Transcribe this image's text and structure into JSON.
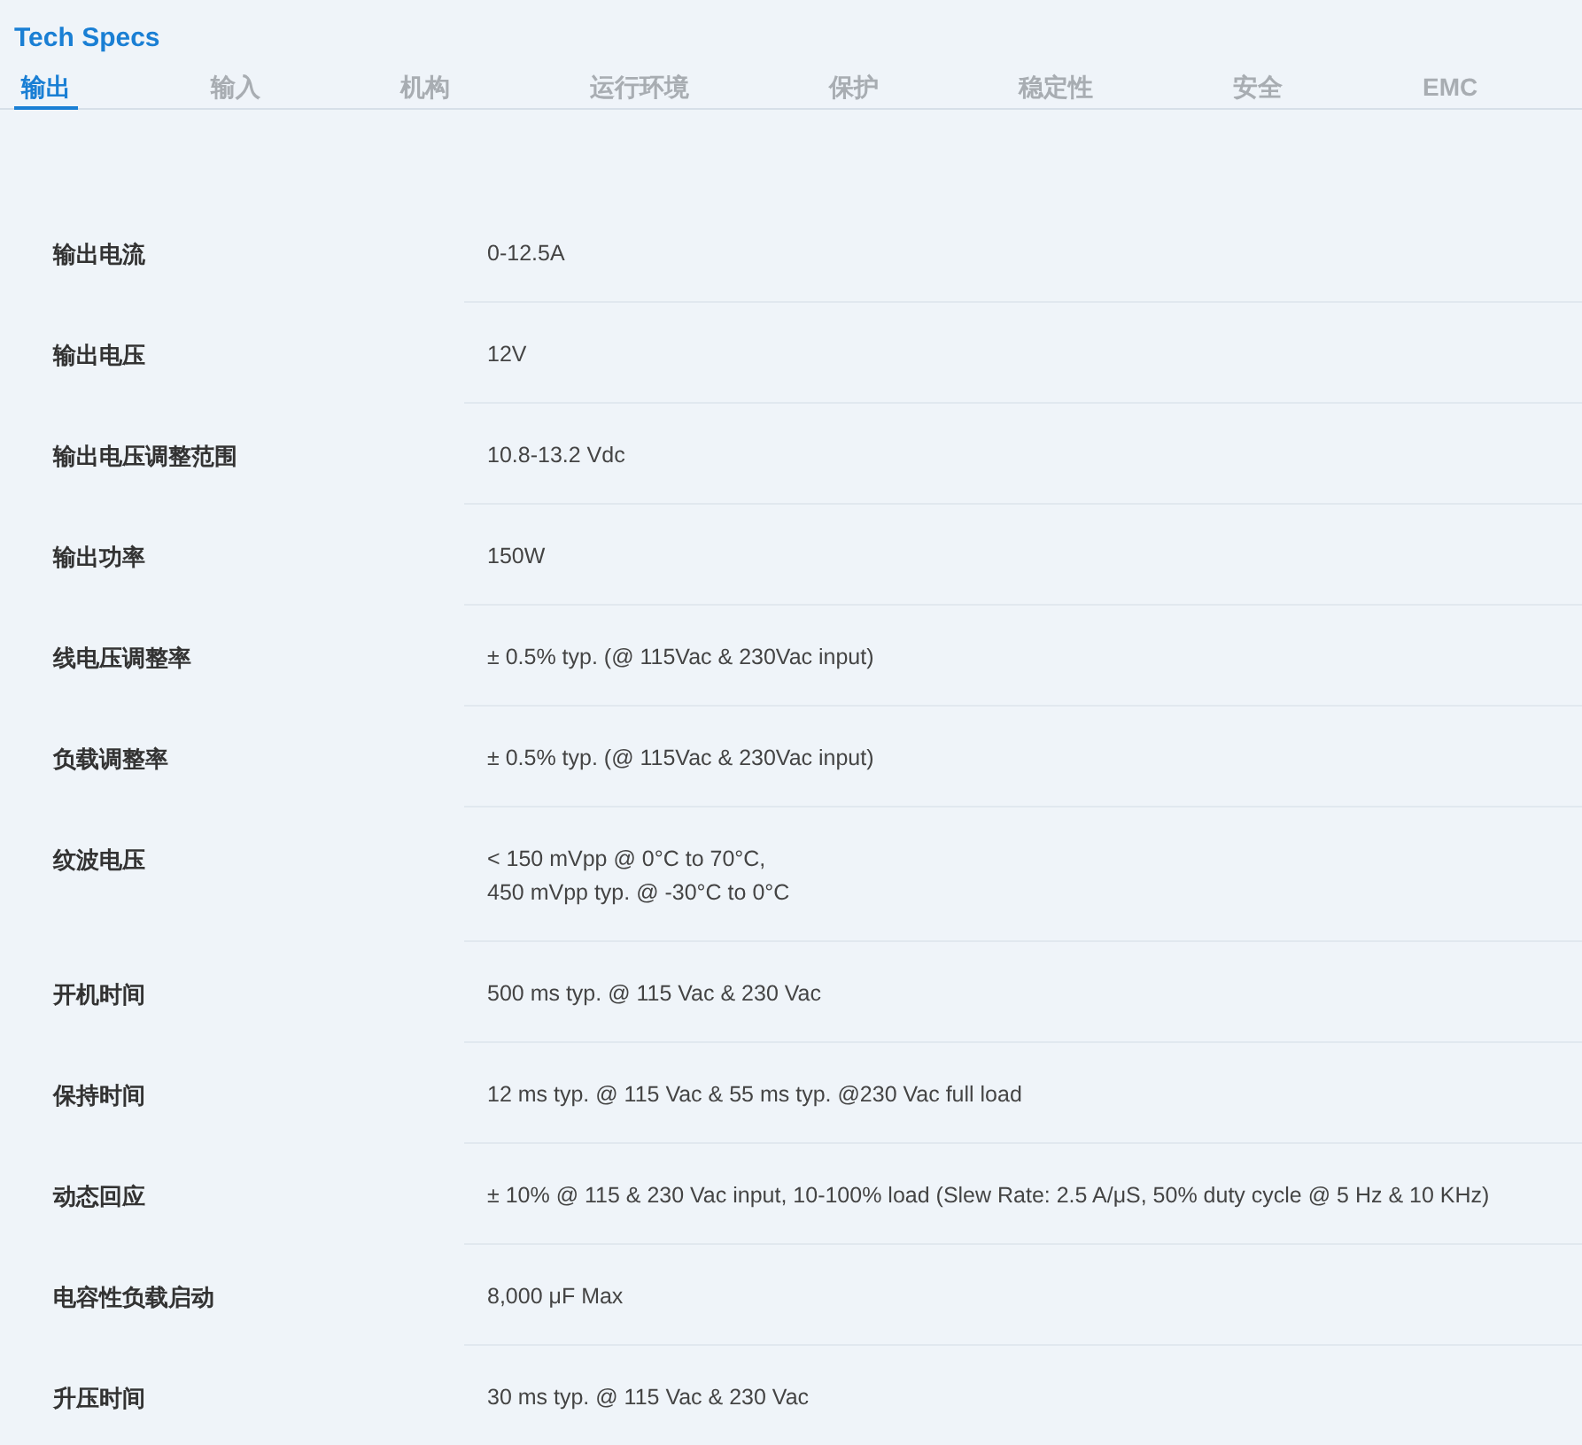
{
  "title": "Tech Specs",
  "tabs": [
    {
      "label": "输出",
      "selected": true
    },
    {
      "label": "输入",
      "selected": false
    },
    {
      "label": "机构",
      "selected": false
    },
    {
      "label": "运行环境",
      "selected": false
    },
    {
      "label": "保护",
      "selected": false
    },
    {
      "label": "稳定性",
      "selected": false
    },
    {
      "label": "安全",
      "selected": false
    },
    {
      "label": "EMC",
      "selected": false
    }
  ],
  "specs": [
    {
      "name": "输出电流",
      "value": [
        "0-12.5A"
      ]
    },
    {
      "name": "输出电压",
      "value": [
        "12V"
      ]
    },
    {
      "name": "输出电压调整范围",
      "value": [
        "10.8-13.2 Vdc"
      ]
    },
    {
      "name": "输出功率",
      "value": [
        "150W"
      ]
    },
    {
      "name": "线电压调整率",
      "value": [
        "± 0.5% typ. (@ 115Vac & 230Vac input)"
      ]
    },
    {
      "name": "负载调整率",
      "value": [
        "± 0.5% typ. (@ 115Vac & 230Vac input)"
      ]
    },
    {
      "name": "纹波电压",
      "value": [
        "< 150 mVpp @ 0°C to 70°C,",
        "450 mVpp typ. @ -30°C to 0°C"
      ]
    },
    {
      "name": "开机时间",
      "value": [
        "500 ms typ. @ 115 Vac & 230 Vac"
      ]
    },
    {
      "name": "保持时间",
      "value": [
        "12 ms typ. @ 115 Vac & 55 ms typ. @230 Vac full load"
      ]
    },
    {
      "name": "动态回应",
      "value": [
        "± 10% @ 115 & 230 Vac input, 10-100% load (Slew Rate: 2.5 A/μS, 50% duty cycle @ 5 Hz & 10 KHz)"
      ]
    },
    {
      "name": "电容性负载启动",
      "value": [
        "8,000 μF Max"
      ]
    },
    {
      "name": "升压时间",
      "value": [
        "30 ms typ. @ 115 Vac & 230 Vac"
      ]
    }
  ]
}
